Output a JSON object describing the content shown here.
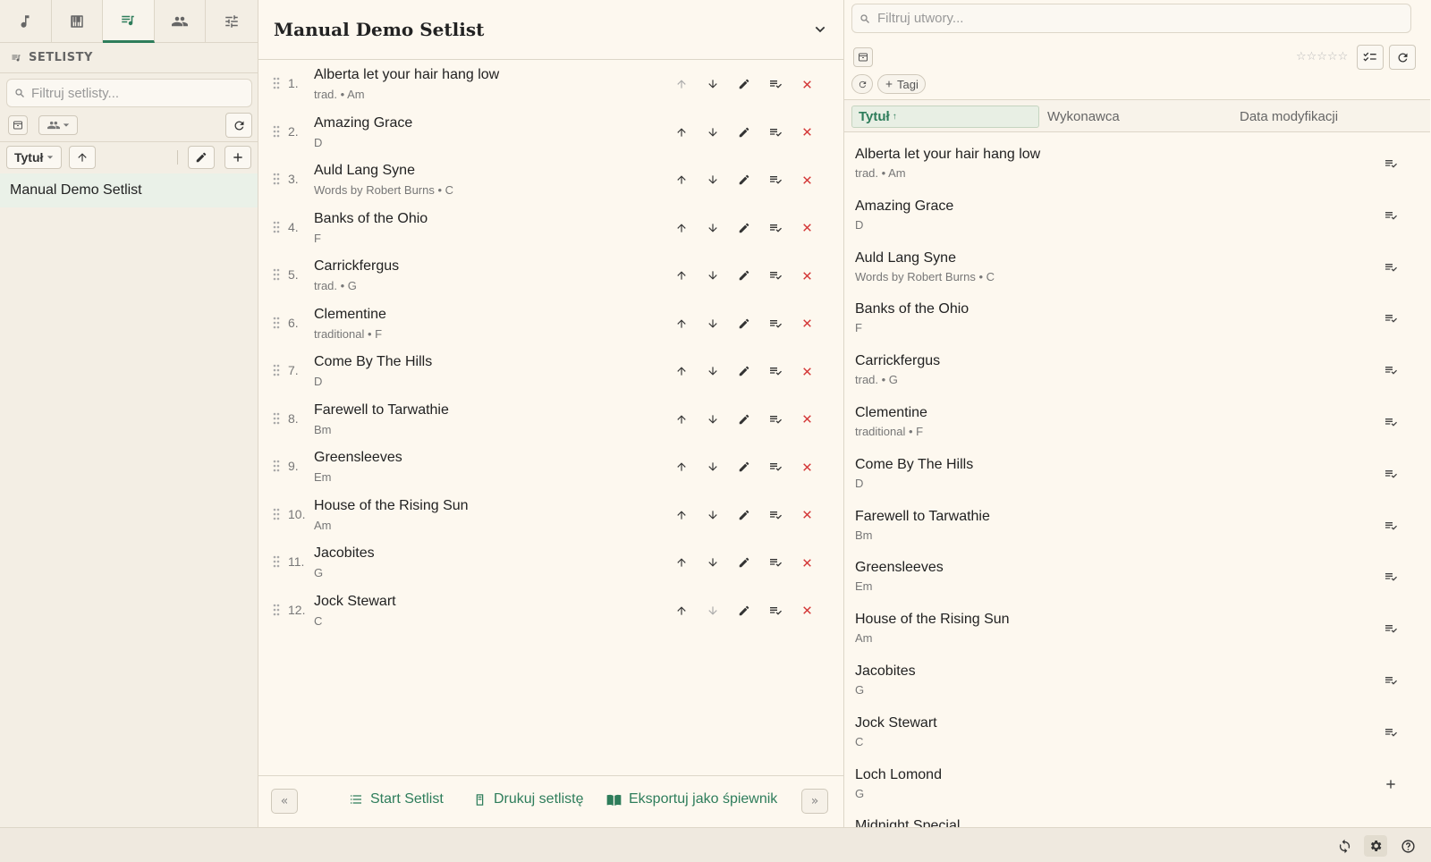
{
  "sidebar": {
    "tabs": [
      {
        "icon": "music-note-icon",
        "label": ""
      },
      {
        "icon": "piano-icon",
        "label": ""
      },
      {
        "icon": "setlist-icon",
        "label": ""
      },
      {
        "icon": "people-icon",
        "label": ""
      },
      {
        "icon": "tune-icon",
        "label": ""
      }
    ],
    "section_title": "SETLISTY",
    "filter_placeholder": "Filtruj setlisty...",
    "sort_label": "Tytuł",
    "setlists": [
      "Manual Demo Setlist"
    ]
  },
  "setlist": {
    "title": "Manual Demo Setlist",
    "songs": [
      {
        "num": "1.",
        "title": "Alberta let your hair hang low",
        "sub": "trad. • Am"
      },
      {
        "num": "2.",
        "title": "Amazing Grace",
        "sub": "D"
      },
      {
        "num": "3.",
        "title": "Auld Lang Syne",
        "sub": "Words by Robert Burns • C"
      },
      {
        "num": "4.",
        "title": "Banks of the Ohio",
        "sub": "F"
      },
      {
        "num": "5.",
        "title": "Carrickfergus",
        "sub": "trad. • G"
      },
      {
        "num": "6.",
        "title": "Clementine",
        "sub": "traditional • F"
      },
      {
        "num": "7.",
        "title": "Come By The Hills",
        "sub": "D"
      },
      {
        "num": "8.",
        "title": "Farewell to Tarwathie",
        "sub": "Bm"
      },
      {
        "num": "9.",
        "title": "Greensleeves",
        "sub": "Em"
      },
      {
        "num": "10.",
        "title": "House of the Rising Sun",
        "sub": "Am"
      },
      {
        "num": "11.",
        "title": "Jacobites",
        "sub": "G"
      },
      {
        "num": "12.",
        "title": "Jock Stewart",
        "sub": "C"
      }
    ],
    "footer": {
      "prev": "«",
      "next": "»",
      "start_label": "Start Setlist",
      "print_label": "Drukuj setlistę",
      "export_label": "Eksportuj jako śpiewnik"
    }
  },
  "library": {
    "filter_placeholder": "Filtruj utwory...",
    "tags_label": "Tagi",
    "stars": "☆☆☆☆☆",
    "columns": {
      "title": "Tytuł",
      "title_sort": "↑",
      "artist": "Wykonawca",
      "modified": "Data modyfikacji"
    },
    "songs": [
      {
        "title": "Alberta let your hair hang low",
        "sub": "trad. • Am",
        "in_setlist": true
      },
      {
        "title": "Amazing Grace",
        "sub": "D",
        "in_setlist": true
      },
      {
        "title": "Auld Lang Syne",
        "sub": "Words by Robert Burns • C",
        "in_setlist": true
      },
      {
        "title": "Banks of the Ohio",
        "sub": "F",
        "in_setlist": true
      },
      {
        "title": "Carrickfergus",
        "sub": "trad. • G",
        "in_setlist": true
      },
      {
        "title": "Clementine",
        "sub": "traditional • F",
        "in_setlist": true
      },
      {
        "title": "Come By The Hills",
        "sub": "D",
        "in_setlist": true
      },
      {
        "title": "Farewell to Tarwathie",
        "sub": "Bm",
        "in_setlist": true
      },
      {
        "title": "Greensleeves",
        "sub": "Em",
        "in_setlist": true
      },
      {
        "title": "House of the Rising Sun",
        "sub": "Am",
        "in_setlist": true
      },
      {
        "title": "Jacobites",
        "sub": "G",
        "in_setlist": true
      },
      {
        "title": "Jock Stewart",
        "sub": "C",
        "in_setlist": true
      },
      {
        "title": "Loch Lomond",
        "sub": "G",
        "in_setlist": false
      },
      {
        "title": "Midnight Special",
        "sub": "",
        "in_setlist": false
      }
    ]
  },
  "colors": {
    "accent": "#2e7d5b",
    "danger": "#d33333",
    "background": "#fdf8ef"
  }
}
